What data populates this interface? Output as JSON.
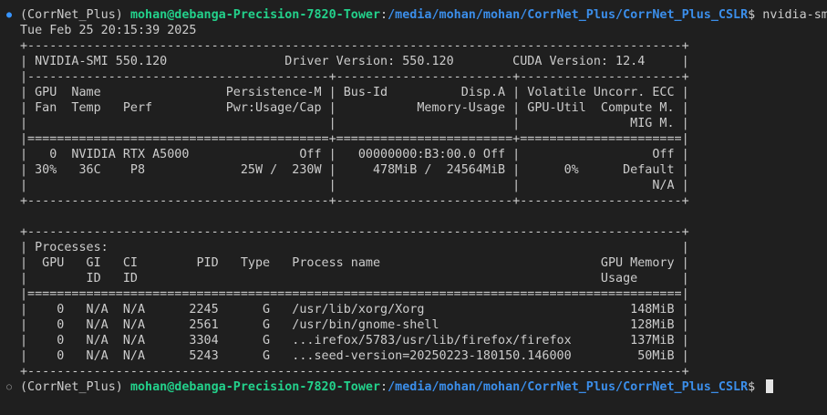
{
  "prompt": {
    "env": "(CorrNet_Plus) ",
    "user_host": "mohan@debanga-Precision-7820-Tower",
    "sep": ":",
    "path": "/media/mohan/mohan/CorrNet_Plus/CorrNet_Plus_CSLR",
    "suffix": "$ ",
    "command": "nvidia-smi"
  },
  "output_lines": [
    "Tue Feb 25 20:15:39 2025",
    "+-----------------------------------------------------------------------------------------+",
    "| NVIDIA-SMI 550.120                Driver Version: 550.120        CUDA Version: 12.4     |",
    "|-----------------------------------------+------------------------+----------------------+",
    "| GPU  Name                 Persistence-M | Bus-Id          Disp.A | Volatile Uncorr. ECC |",
    "| Fan  Temp   Perf          Pwr:Usage/Cap |           Memory-Usage | GPU-Util  Compute M. |",
    "|                                         |                        |               MIG M. |",
    "|=========================================+========================+======================|",
    "|   0  NVIDIA RTX A5000               Off |   00000000:B3:00.0 Off |                  Off |",
    "| 30%   36C    P8             25W /  230W |     478MiB /  24564MiB |      0%      Default |",
    "|                                         |                        |                  N/A |",
    "+-----------------------------------------+------------------------+----------------------+",
    "",
    "+-----------------------------------------------------------------------------------------+",
    "| Processes:                                                                              |",
    "|  GPU   GI   CI        PID   Type   Process name                              GPU Memory |",
    "|        ID   ID                                                               Usage      |",
    "|=========================================================================================|",
    "|    0   N/A  N/A      2245      G   /usr/lib/xorg/Xorg                            148MiB |",
    "|    0   N/A  N/A      2561      G   /usr/bin/gnome-shell                          128MiB |",
    "|    0   N/A  N/A      3304      G   ...irefox/5783/usr/lib/firefox/firefox        137MiB |",
    "|    0   N/A  N/A      5243      G   ...seed-version=20250223-180150.146000         50MiB |",
    "+-----------------------------------------------------------------------------------------+"
  ],
  "gutter": {
    "active_marker": "●",
    "idle_marker": "○"
  },
  "colors": {
    "background": "#1f1f1f",
    "text": "#cccccc",
    "user_host": "#23d18b",
    "path": "#3b8eea",
    "active_marker": "#3794ff"
  }
}
